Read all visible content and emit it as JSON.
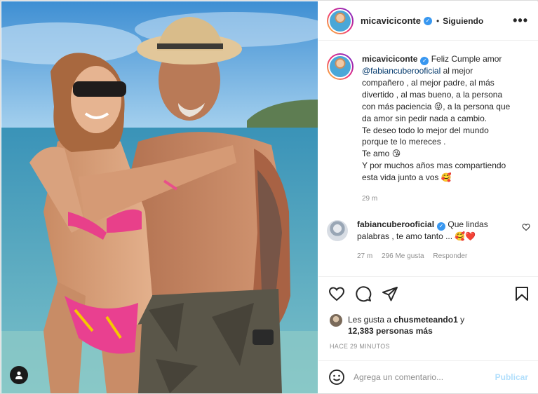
{
  "post": {
    "username": "micaviciconte",
    "follow_status": "Siguiendo",
    "more_label": "•••",
    "separator": "•",
    "verified_mark": "✓"
  },
  "caption": {
    "username": "micaviciconte",
    "line1": " Feliz Cumple amor",
    "mention": "@fabiancuberooficial",
    "line2": " al mejor",
    "line3": "compañero , al mejor padre, al más",
    "line4": "divertido , al mas bueno, a la persona",
    "line5a": "con más paciencia ",
    "emoji1": "😜",
    "line5b": ", a la persona que",
    "line6": "da amor sin pedir nada a cambio.",
    "line7": "Te deseo todo lo mejor del mundo",
    "line8": "porque te lo mereces .",
    "line9": "Te amo ",
    "emoji2": "😘",
    "line10": "Y por muchos años mas compartiendo",
    "line11": "esta vida junto a vos ",
    "emoji3": "🥰",
    "time": "29 m"
  },
  "reply": {
    "username": "fabiancuberooficial",
    "text": " Que lindas palabras , te amo tanto ... ",
    "emoji": "🥰",
    "heart": "❤️",
    "time": "27 m",
    "likes": "296 Me gusta",
    "reply_label": "Responder"
  },
  "likes": {
    "prefix": "Les gusta a ",
    "user": "chusmeteando1",
    "suffix": " y",
    "count": "12,383 personas más"
  },
  "posted_ago": "HACE 29 MINUTOS",
  "comment_box": {
    "placeholder": "Agrega un comentario...",
    "publish_label": "Publicar"
  },
  "icons": {
    "like": "heart-icon",
    "comment": "comment-icon",
    "share": "paper-plane-icon",
    "save": "bookmark-icon",
    "emoji": "smiley-icon",
    "tagged": "user-tag-icon"
  },
  "colors": {
    "verified": "#3897f0",
    "mention": "#00376b",
    "publish": "#b2dffc",
    "muted": "#8e8e8e",
    "text": "#262626"
  }
}
